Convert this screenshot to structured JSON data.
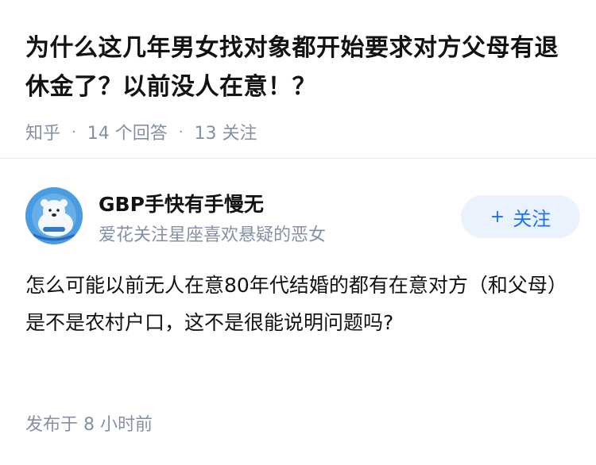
{
  "question": {
    "title": "为什么这几年男女找对象都开始要求对方父母有退休金了？以前没人在意！？",
    "source": "知乎",
    "answers": "14 个回答",
    "followers": "13 关注"
  },
  "author": {
    "name": "GBP手快有手慢无",
    "bio": "爱花关注星座喜欢悬疑的恶女",
    "follow_label": "关注",
    "follow_plus": "+"
  },
  "answer": {
    "content": "怎么可能以前无人在意80年代结婚的都有在意对方（和父母）是不是农村户口，这不是很能说明问题吗?",
    "time": "发布于 8 小时前"
  },
  "colors": {
    "meta_gray": "#8590a6",
    "accent_blue": "#1772f6",
    "follow_bg": "#eaf2fd"
  }
}
